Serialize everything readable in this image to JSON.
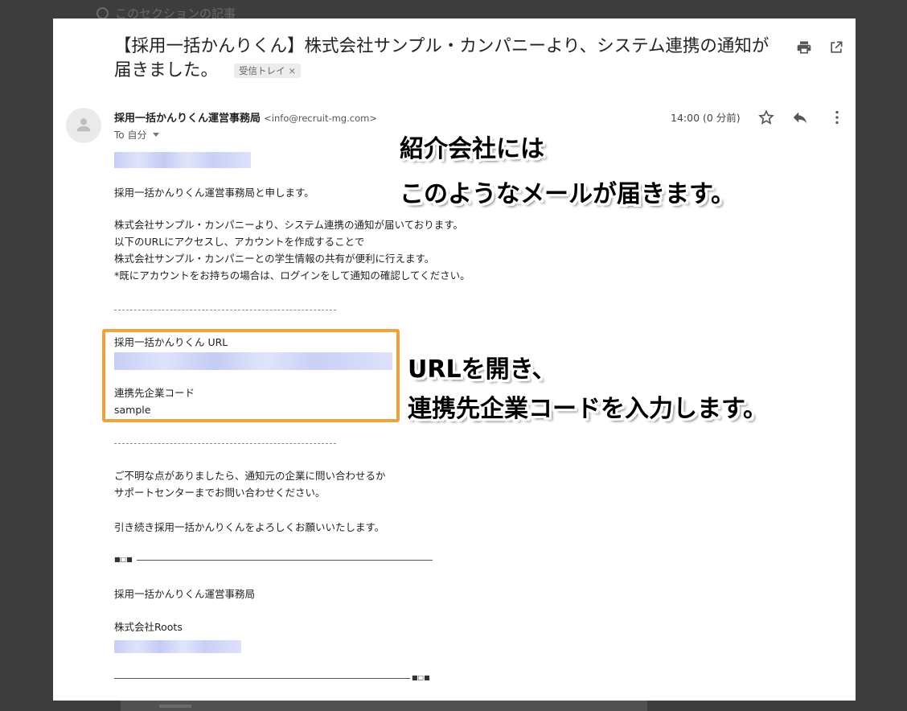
{
  "background": {
    "section_text": "このセクションの記事"
  },
  "email": {
    "subject": "【採用一括かんりくん】株式会社サンプル・カンパニーより、システム連携の通知が届きました。",
    "label": "受信トレイ",
    "label_close": "×",
    "sender_name": "採用一括かんりくん運営事務局",
    "sender_email": "<info@recruit-mg.com>",
    "to": "To 自分",
    "time": "14:00 (0 分前)",
    "body": {
      "intro": "採用一括かんりくん運営事務局と申します。",
      "para1": [
        "株式会社サンプル・カンパニーより、システム連携の通知が届いております。",
        "以下のURLにアクセスし、アカウントを作成することで",
        "株式会社サンプル・カンパニーとの学生情報の共有が便利に行えます。",
        "*既にアカウントをお持ちの場合は、ログインをして通知の確認してください。"
      ],
      "url_label": "採用一括かんりくん URL",
      "code_label": "連携先企業コード",
      "code_value": "sample",
      "para2": [
        "ご不明な点がありましたら、通知元の企業に問い合わせるか",
        "サポートセンターまでお問い合わせください。"
      ],
      "closing": "引き続き採用一括かんりくんをよろしくお願いいたします。",
      "sig_marker_start": "■□■",
      "sig_org": "採用一括かんりくん運営事務局",
      "sig_company": "株式会社Roots",
      "sig_marker_end": "■□■"
    }
  },
  "annotations": {
    "note1_line1": "紹介会社には",
    "note1_line2": "このようなメールが届きます。",
    "note2_line1": "URLを開き、",
    "note2_line2": "連携先企業コードを入力します。"
  },
  "colors": {
    "highlight": "#f0a03c",
    "backdrop": "#3d3d3d"
  },
  "icons": [
    "search-icon",
    "print-icon",
    "popout-icon",
    "avatar-icon",
    "star-icon",
    "reply-icon",
    "more-icon"
  ]
}
